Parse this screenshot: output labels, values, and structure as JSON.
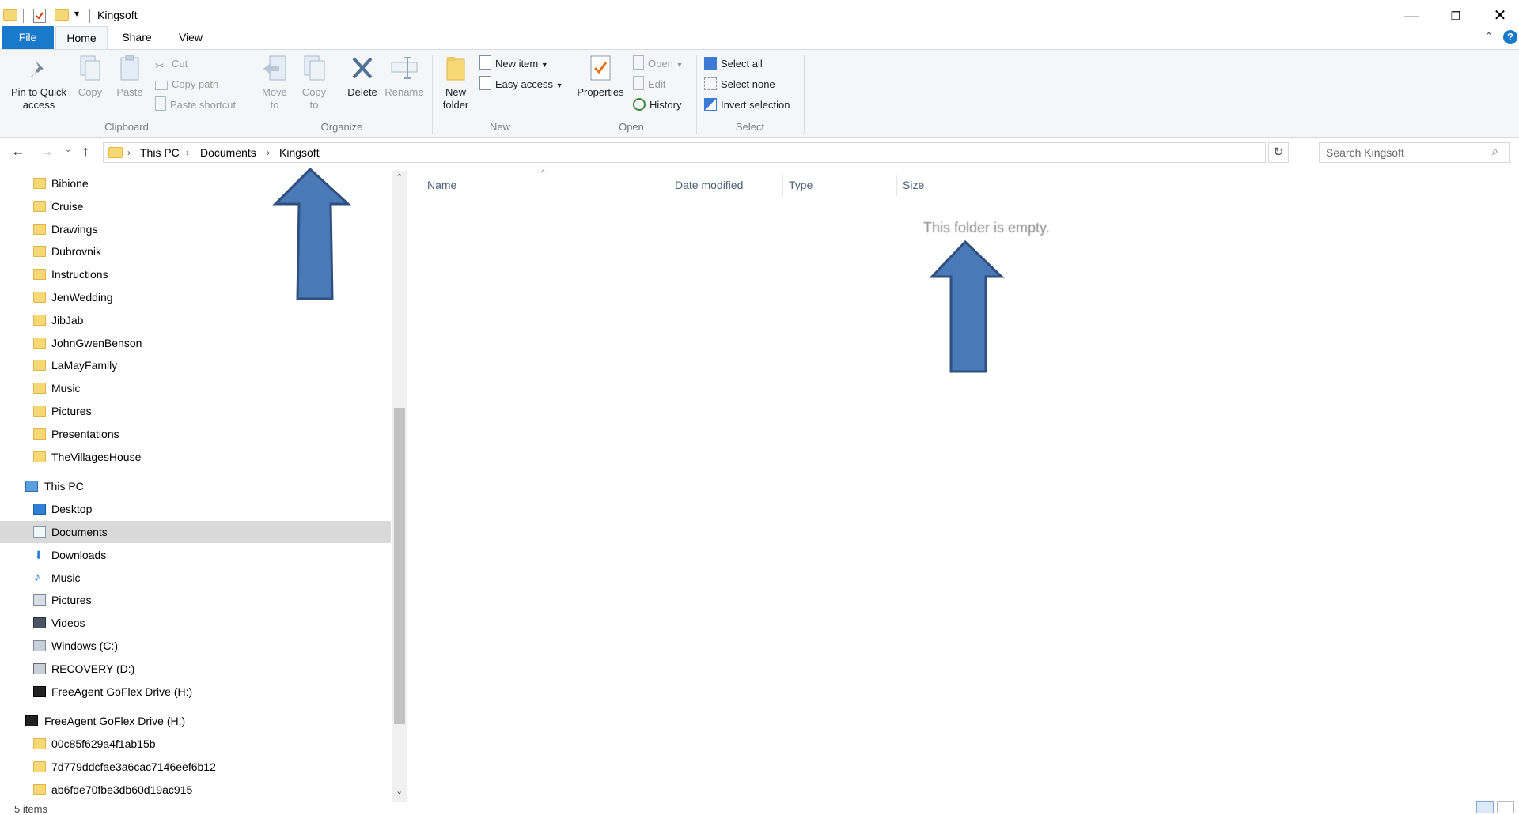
{
  "window": {
    "title": "Kingsoft"
  },
  "tabs": [
    {
      "label": "File"
    },
    {
      "label": "Home"
    },
    {
      "label": "Share"
    },
    {
      "label": "View"
    }
  ],
  "ribbon": {
    "clipboard": {
      "group_label": "Clipboard",
      "pin_label": "Pin to Quick access",
      "copy_label": "Copy",
      "paste_label": "Paste",
      "cut_label": "Cut",
      "copy_path_label": "Copy path",
      "paste_shortcut_label": "Paste shortcut"
    },
    "organize": {
      "group_label": "Organize",
      "move_to_label": "Move to",
      "copy_to_label": "Copy to",
      "delete_label": "Delete",
      "rename_label": "Rename"
    },
    "new": {
      "group_label": "New",
      "new_folder_label": "New folder",
      "new_item_label": "New item",
      "easy_access_label": "Easy access"
    },
    "open": {
      "group_label": "Open",
      "properties_label": "Properties",
      "open_label": "Open",
      "edit_label": "Edit",
      "history_label": "History"
    },
    "select": {
      "group_label": "Select",
      "select_all_label": "Select all",
      "select_none_label": "Select none",
      "invert_label": "Invert selection"
    }
  },
  "address": {
    "crumbs": [
      "This PC",
      "Documents",
      "Kingsoft"
    ],
    "search_placeholder": "Search Kingsoft"
  },
  "nav": {
    "folders": [
      "Bibione",
      "Cruise",
      "Drawings",
      "Dubrovnik",
      "Instructions",
      "JenWedding",
      "JibJab",
      "JohnGwenBenson",
      "LaMayFamily",
      "Music",
      "Pictures",
      "Presentations",
      "TheVillagesHouse"
    ],
    "this_pc": "This PC",
    "pc_items": [
      "Desktop",
      "Documents",
      "Downloads",
      "Music",
      "Pictures",
      "Videos",
      "Windows (C:)",
      "RECOVERY (D:)",
      "FreeAgent GoFlex Drive (H:)"
    ],
    "drive": "FreeAgent GoFlex Drive (H:)",
    "drive_items": [
      "00c85f629a4f1ab15b",
      "7d779ddcfae3a6cac7146eef6b12",
      "ab6fde70fbe3db60d19ac915"
    ]
  },
  "columns": {
    "name": "Name",
    "date": "Date modified",
    "type": "Type",
    "size": "Size"
  },
  "content": {
    "empty_message": "This folder is empty."
  },
  "status": {
    "items": "5 items"
  },
  "colors": {
    "file_tab": "#1979ca",
    "arrow_fill": "#4a79b8",
    "arrow_stroke": "#2f4f7f"
  }
}
